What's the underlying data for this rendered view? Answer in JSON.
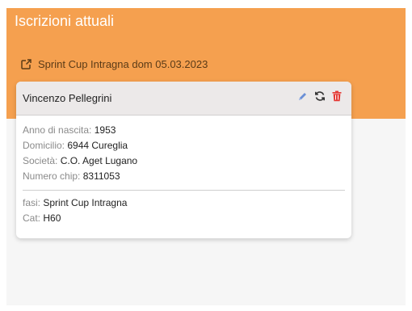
{
  "header": {
    "title": "Iscrizioni attuali",
    "event_link": "Sprint Cup Intragna dom 05.03.2023"
  },
  "card": {
    "name": "Vincenzo Pellegrini",
    "details": [
      {
        "label": "Anno di nascita:",
        "value": "1953"
      },
      {
        "label": "Domicilio:",
        "value": "6944 Cureglia"
      },
      {
        "label": "Società:",
        "value": "C.O. Aget Lugano"
      },
      {
        "label": "Numero chip:",
        "value": "8311053"
      }
    ],
    "extra": [
      {
        "label": "fasi:",
        "value": "Sprint Cup Intragna"
      },
      {
        "label": "Cat:",
        "value": "H60"
      }
    ]
  },
  "colors": {
    "header_bg": "#f5a04f",
    "edit_icon": "#6b8fd6",
    "refresh_icon": "#333333",
    "delete_icon": "#e53935"
  },
  "icons": [
    "external-link-icon",
    "pencil-icon",
    "refresh-icon",
    "trash-icon"
  ]
}
